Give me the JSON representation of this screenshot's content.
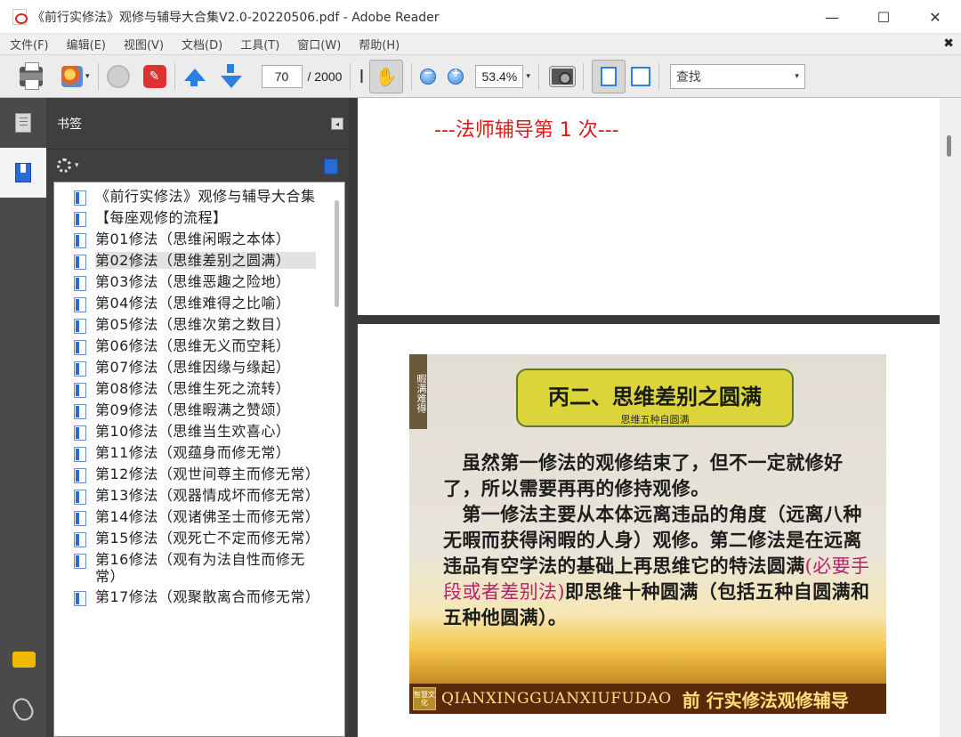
{
  "window": {
    "title": "《前行实修法》观修与辅导大合集V2.0-20220506.pdf - Adobe Reader",
    "minimize": "—",
    "maximize": "☐",
    "close": "✕"
  },
  "menu": {
    "items": [
      "文件(F)",
      "编辑(E)",
      "视图(V)",
      "文档(D)",
      "工具(T)",
      "窗口(W)",
      "帮助(H)"
    ],
    "close_doc": "✖"
  },
  "toolbar": {
    "page_current": "70",
    "page_total": "/ 2000",
    "zoom_value": "53.4%",
    "find_placeholder": "查找",
    "zoom_out_glyph": "−",
    "zoom_in_glyph": "+",
    "select_glyph": "I",
    "hand_glyph": "✋",
    "share_caret": "▾",
    "zoom_caret": "▾",
    "find_caret": "▾"
  },
  "panel": {
    "title": "书签",
    "collapse_glyph": "◂",
    "options_caret": "▾",
    "bookmarks": [
      {
        "label": "《前行实修法》观修与辅导大合集"
      },
      {
        "label": "【每座观修的流程】"
      },
      {
        "label": "第01修法（思维闲暇之本体）"
      },
      {
        "label": "第02修法（思维差别之圆满）",
        "selected": true
      },
      {
        "label": "第03修法（思维恶趣之险地）"
      },
      {
        "label": "第04修法（思维难得之比喻）"
      },
      {
        "label": "第05修法（思维次第之数目）"
      },
      {
        "label": "第06修法（思维无义而空耗）"
      },
      {
        "label": "第07修法（思维因缘与缘起）"
      },
      {
        "label": "第08修法（思维生死之流转）"
      },
      {
        "label": "第09修法（思维暇满之赞颂）"
      },
      {
        "label": "第10修法（思维当生欢喜心）"
      },
      {
        "label": "第11修法（观蕴身而修无常）"
      },
      {
        "label": "第12修法（观世间尊主而修无常）"
      },
      {
        "label": "第13修法（观器情成坏而修无常）"
      },
      {
        "label": "第14修法（观诸佛圣士而修无常）"
      },
      {
        "label": "第15修法（观死亡不定而修无常）"
      },
      {
        "label": "第16修法（观有为法自性而修无常）"
      },
      {
        "label": "第17修法（观聚散离合而修无常）"
      }
    ]
  },
  "document": {
    "page1_heading": "---法师辅导第 1 次---",
    "slide": {
      "side_text": "暇满难得",
      "title": "丙二、思维差别之圆满",
      "subtitle": "思维五种自圆满",
      "body_part1": "　虽然第一修法的观修结束了，但不一定就修好了，所以需要再再的修持观修。\n　第一修法主要从本体远离违品的角度（远离八种无暇而获得闲暇的人身）观修。第二修法是在远离违品有空学法的基础上再思维它的特法圆满",
      "body_pink": "(必要手段或者差别法)",
      "body_part2": "即思维十种圆满（包括五种自圆满和五种他圆满）。",
      "footer_badge": "智慧文化",
      "footer_en": "QIANXINGGUANXIUFUDAO",
      "footer_cn": "前  行实修法观修辅导"
    }
  },
  "colors": {
    "heading_red": "#e01818",
    "slide_title_bg": "#dcd53a",
    "accent_pink": "#b82070"
  }
}
